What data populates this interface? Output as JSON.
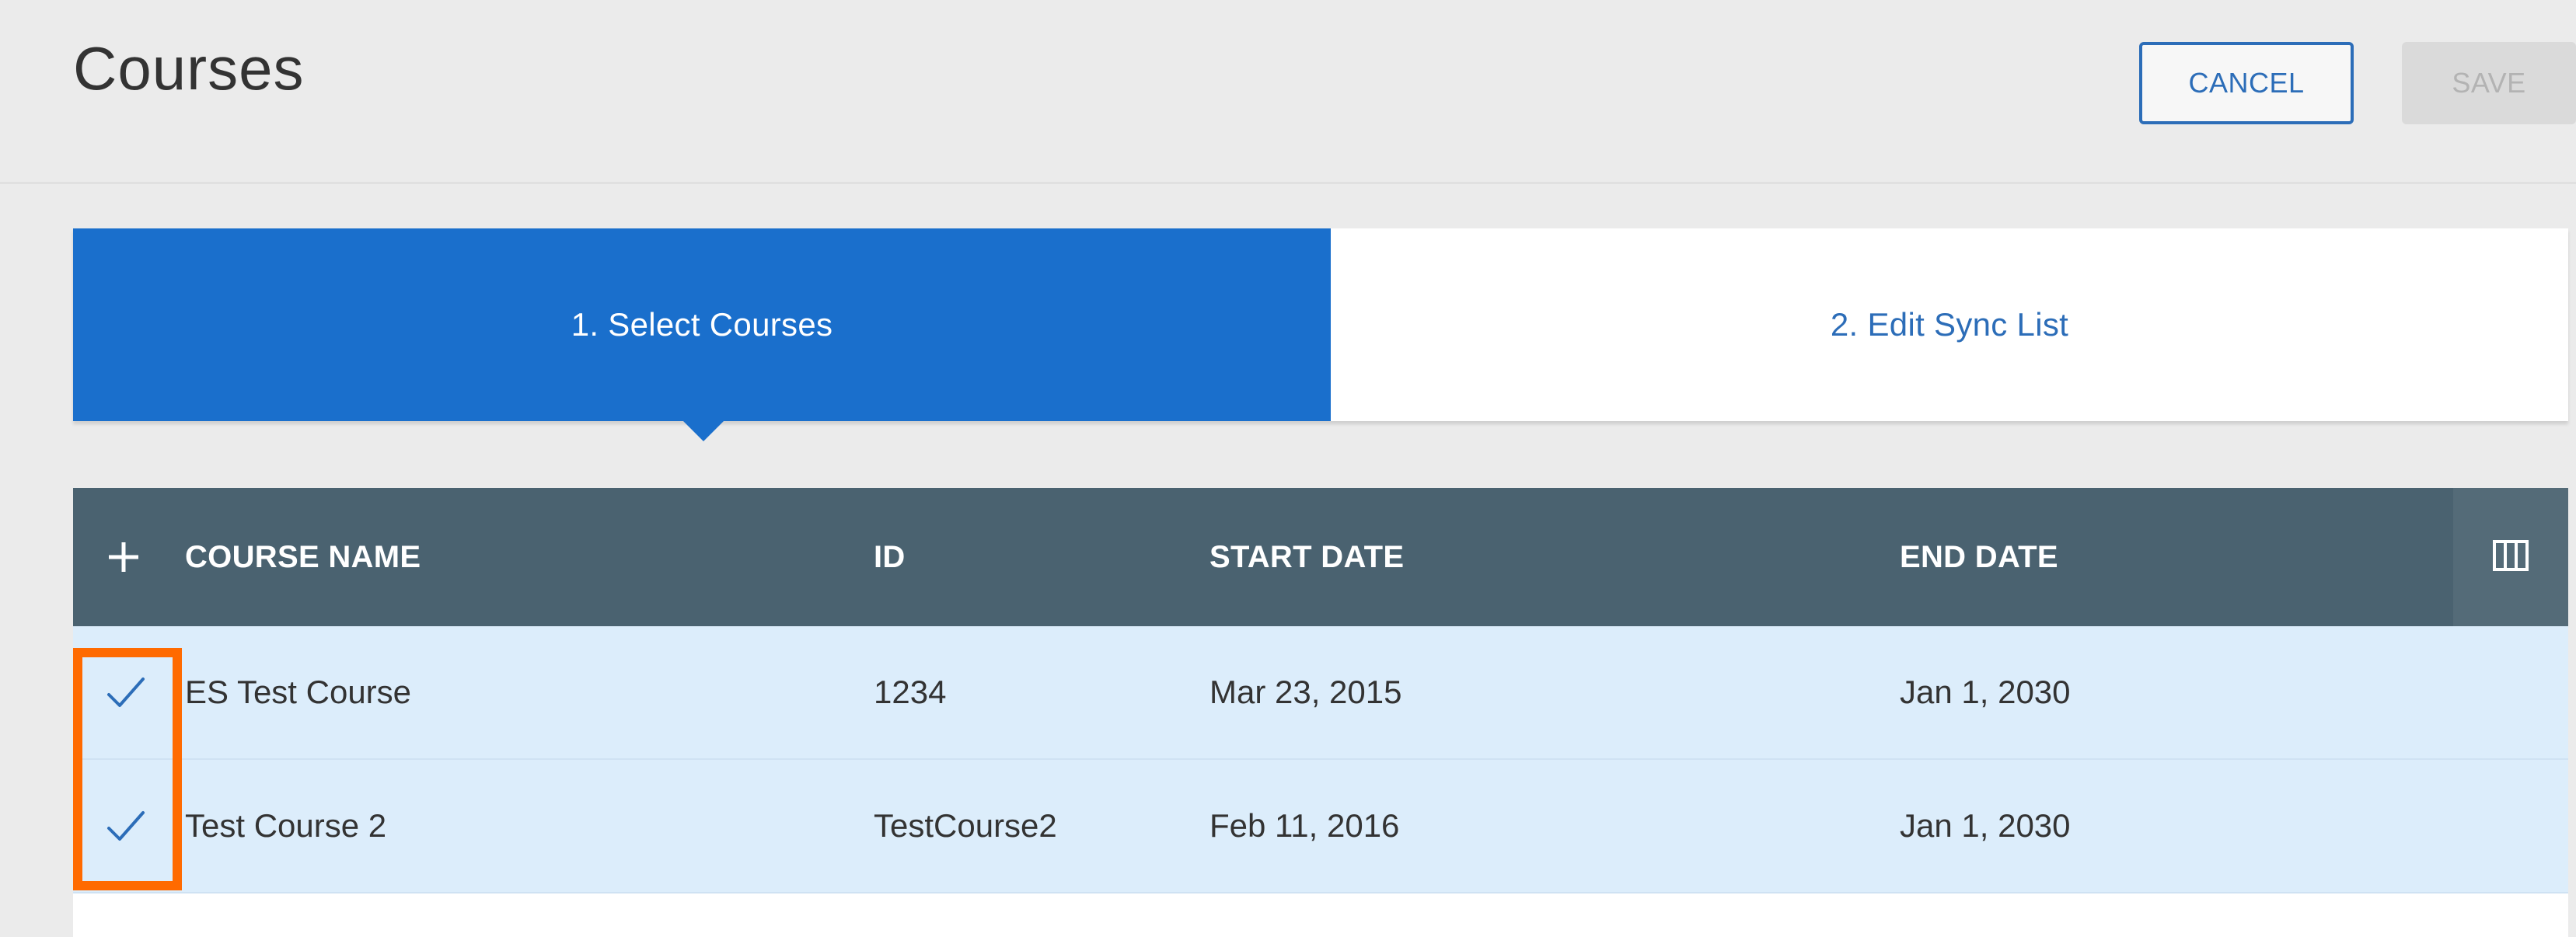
{
  "header": {
    "title": "Courses",
    "cancel_label": "CANCEL",
    "save_label": "SAVE"
  },
  "stepper": {
    "steps": [
      {
        "label": "1. Select Courses",
        "active": true
      },
      {
        "label": "2. Edit Sync List",
        "active": false
      }
    ]
  },
  "table": {
    "columns": [
      "COURSE NAME",
      "ID",
      "START DATE",
      "END DATE"
    ],
    "header_icons": {
      "add": "plus-icon",
      "columns": "columns-icon"
    },
    "rows": [
      {
        "checked": true,
        "course_name": "ES Test Course",
        "id": "1234",
        "start_date": "Mar 23, 2015",
        "end_date": "Jan 1, 2030"
      },
      {
        "checked": true,
        "course_name": "Test Course 2",
        "id": "TestCourse2",
        "start_date": "Feb 11, 2016",
        "end_date": "Jan 1, 2030"
      }
    ]
  },
  "colors": {
    "primary": "#1a6fcc",
    "table_header": "#4a6270",
    "selected_row": "#dcedfb",
    "highlight": "#ff6a00"
  }
}
